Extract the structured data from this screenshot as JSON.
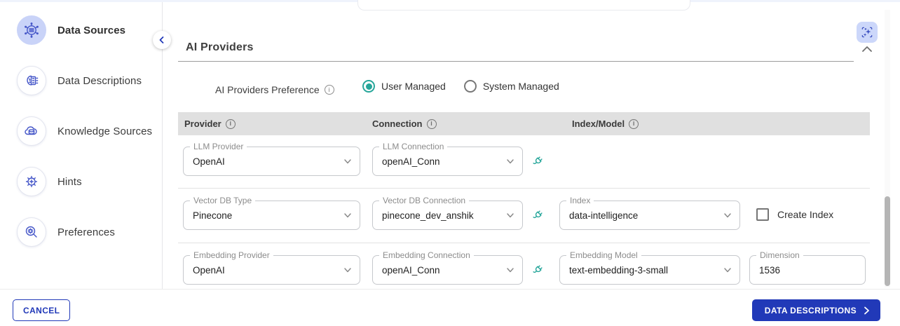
{
  "sidebar": {
    "items": [
      {
        "label": "Data Sources",
        "active": true
      },
      {
        "label": "Data Descriptions",
        "active": false
      },
      {
        "label": "Knowledge Sources",
        "active": false
      },
      {
        "label": "Hints",
        "active": false
      },
      {
        "label": "Preferences",
        "active": false
      }
    ]
  },
  "panel": {
    "section_title": "AI Providers",
    "preference": {
      "label": "AI Providers Preference",
      "options": [
        {
          "label": "User Managed",
          "selected": true
        },
        {
          "label": "System Managed",
          "selected": false
        }
      ]
    },
    "table": {
      "columns": [
        "Provider",
        "Connection",
        "Index/Model"
      ],
      "rows": [
        {
          "fields": [
            {
              "label": "LLM Provider",
              "value": "OpenAI"
            },
            {
              "label": "LLM Connection",
              "value": "openAI_Conn"
            }
          ]
        },
        {
          "fields": [
            {
              "label": "Vector DB Type",
              "value": "Pinecone"
            },
            {
              "label": "Vector DB Connection",
              "value": "pinecone_dev_anshik"
            },
            {
              "label": "Index",
              "value": "data-intelligence"
            }
          ],
          "create_index_label": "Create Index"
        },
        {
          "fields": [
            {
              "label": "Embedding Provider",
              "value": "OpenAI"
            },
            {
              "label": "Embedding Connection",
              "value": "openAI_Conn"
            },
            {
              "label": "Embedding Model",
              "value": "text-embedding-3-small"
            },
            {
              "label": "Dimension",
              "value": "1536"
            }
          ]
        }
      ]
    }
  },
  "footer": {
    "cancel_label": "CANCEL",
    "next_label": "DATA DESCRIPTIONS"
  },
  "colors": {
    "accent_blue": "#2139b8",
    "accent_teal": "#26a69a",
    "accent_indigo": "#4556c8",
    "active_item_bg": "#c9d3f8",
    "table_header_bg": "#e0e0e0"
  }
}
